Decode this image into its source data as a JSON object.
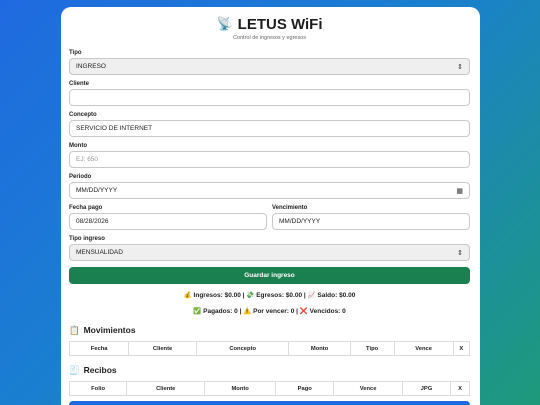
{
  "app": {
    "icon": "satellite-dish-icon",
    "title": "LETUS WiFi",
    "subtitle": "Control de ingresos y egresos"
  },
  "form": {
    "tipo": {
      "label": "Tipo",
      "value": "INGRESO"
    },
    "cliente": {
      "label": "Cliente",
      "value": ""
    },
    "concepto": {
      "label": "Concepto",
      "value": "SERVICIO DE INTERNET"
    },
    "monto": {
      "label": "Monto",
      "placeholder": "EJ: 650"
    },
    "periodo": {
      "label": "Periodo",
      "value": "MM/DD/YYYY"
    },
    "fecha_pago": {
      "label": "Fecha pago",
      "value": "08/28/2026"
    },
    "vencimiento": {
      "label": "Vencimiento",
      "value": "MM/DD/YYYY"
    },
    "tipo_ingreso": {
      "label": "Tipo ingreso",
      "value": "MENSUALIDAD"
    },
    "save_label": "Guardar ingreso"
  },
  "summary": {
    "totals": "💰 Ingresos: $0.00 | 💸 Egresos: $0.00 | 📈 Saldo: $0.00",
    "status": "✅ Pagados: 0 | ⚠️ Por vencer: 0 | ❌ Vencidos: 0"
  },
  "movimientos": {
    "icon": "📋",
    "title": "Movimientos",
    "columns": [
      "Fecha",
      "Cliente",
      "Concepto",
      "Monto",
      "Tipo",
      "Vence",
      "X"
    ]
  },
  "recibos": {
    "icon": "🧾",
    "title": "Recibos",
    "columns": [
      "Folio",
      "Cliente",
      "Monto",
      "Pago",
      "Vence",
      "JPG",
      "X"
    ]
  },
  "colors": {
    "primary": "#1f6ae0",
    "save": "#1a8050"
  }
}
